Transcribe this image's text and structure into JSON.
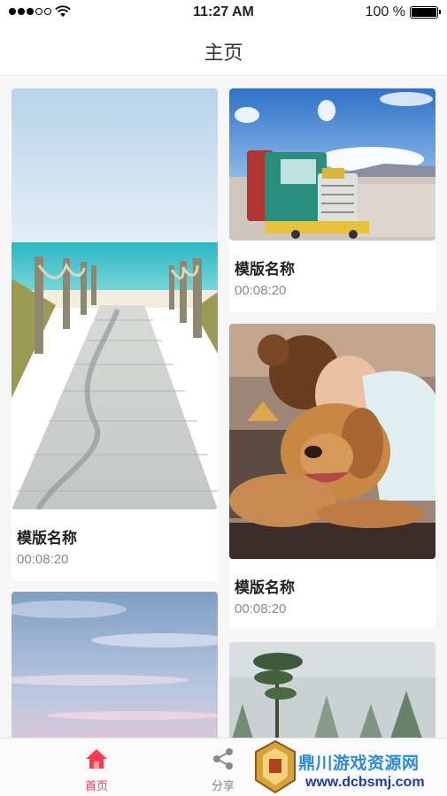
{
  "status_bar": {
    "time": "11:27 AM",
    "battery_text": "100 %",
    "signal_bars_filled": 3,
    "signal_bars_total": 5,
    "battery_level": 1.0
  },
  "nav": {
    "title": "主页"
  },
  "cards": [
    {
      "title": "模版名称",
      "duration": "00:08:20",
      "image": "beach-boardwalk-photo"
    },
    {
      "title": "模版名称",
      "duration": "00:08:20",
      "image": "sightseeing-train-photo"
    },
    {
      "title": "模版名称",
      "duration": "00:08:20",
      "image": "woman-hugging-dog-photo"
    },
    {
      "title": "",
      "duration": "",
      "image": "pastel-sky-photo"
    },
    {
      "title": "",
      "duration": "",
      "image": "misty-forest-photo"
    }
  ],
  "tab_bar": {
    "tabs": [
      {
        "label": "首页",
        "icon": "home-icon",
        "active": true
      },
      {
        "label": "分享",
        "icon": "share-icon",
        "active": false
      }
    ],
    "active_color": "#ff3b52",
    "inactive_color": "#888888"
  },
  "watermark": {
    "text": "鼎川游戏资源网",
    "url": "www.dcbsmj.com"
  }
}
